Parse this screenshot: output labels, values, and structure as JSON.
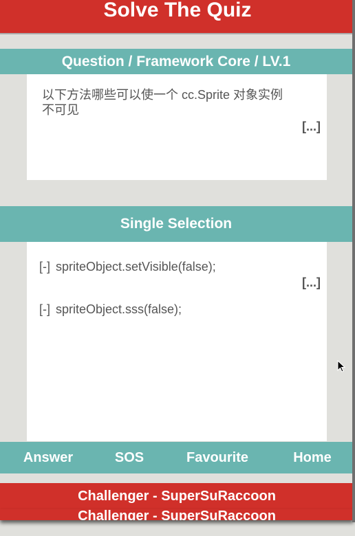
{
  "header": {
    "title": "Solve The Quiz"
  },
  "question": {
    "breadcrumb": "Question / Framework Core / LV.1",
    "line1": "以下方法哪些可以使一个 cc.Sprite 对象实例",
    "line2": "不可见",
    "more": "[...]"
  },
  "answers": {
    "mode_label": "Single Selection",
    "options": [
      {
        "marker": "[-]",
        "text": "spriteObject.setVisible(false);",
        "more": "[...]"
      },
      {
        "marker": "[-]",
        "text": "spriteObject.sss(false);"
      }
    ]
  },
  "nav": {
    "answer": "Answer",
    "sos": "SOS",
    "favourite": "Favourite",
    "home": "Home"
  },
  "footer": {
    "challenger": "Challenger - SuperSuRaccoon"
  },
  "colors": {
    "red": "#d0302a",
    "teal": "#6ab5b0",
    "bg": "#e0e0dc"
  }
}
